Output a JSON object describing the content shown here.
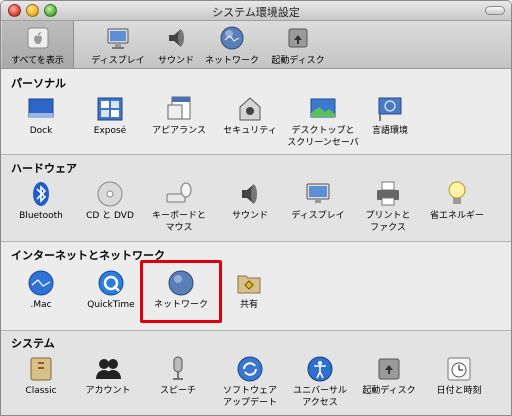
{
  "window": {
    "title": "システム環境設定"
  },
  "toolbar": {
    "show_all": "すべてを表示",
    "items": [
      "ディスプレイ",
      "サウンド",
      "ネットワーク",
      "起動ディスク"
    ]
  },
  "sections": {
    "personal": {
      "title": "パーソナル",
      "items": [
        "Dock",
        "Exposé",
        "アピアランス",
        "セキュリティ",
        "デスクトップと",
        "スクリーンセーバ",
        "言語環境"
      ]
    },
    "hardware": {
      "title": "ハードウェア",
      "items": [
        "Bluetooth",
        "CD と DVD",
        "キーボードと",
        "マウス",
        "サウンド",
        "ディスプレイ",
        "プリントと",
        "ファクス",
        "省エネルギー"
      ]
    },
    "internet": {
      "title": "インターネットとネットワーク",
      "items": [
        ".Mac",
        "QuickTime",
        "ネットワーク",
        "共有"
      ]
    },
    "system": {
      "title": "システム",
      "items": [
        "Classic",
        "アカウント",
        "スピーチ",
        "ソフトウェア",
        "アップデート",
        "ユニバーサル",
        "アクセス",
        "起動ディスク",
        "日付と時刻"
      ]
    }
  },
  "colors": {
    "highlight": "#e0000d"
  }
}
